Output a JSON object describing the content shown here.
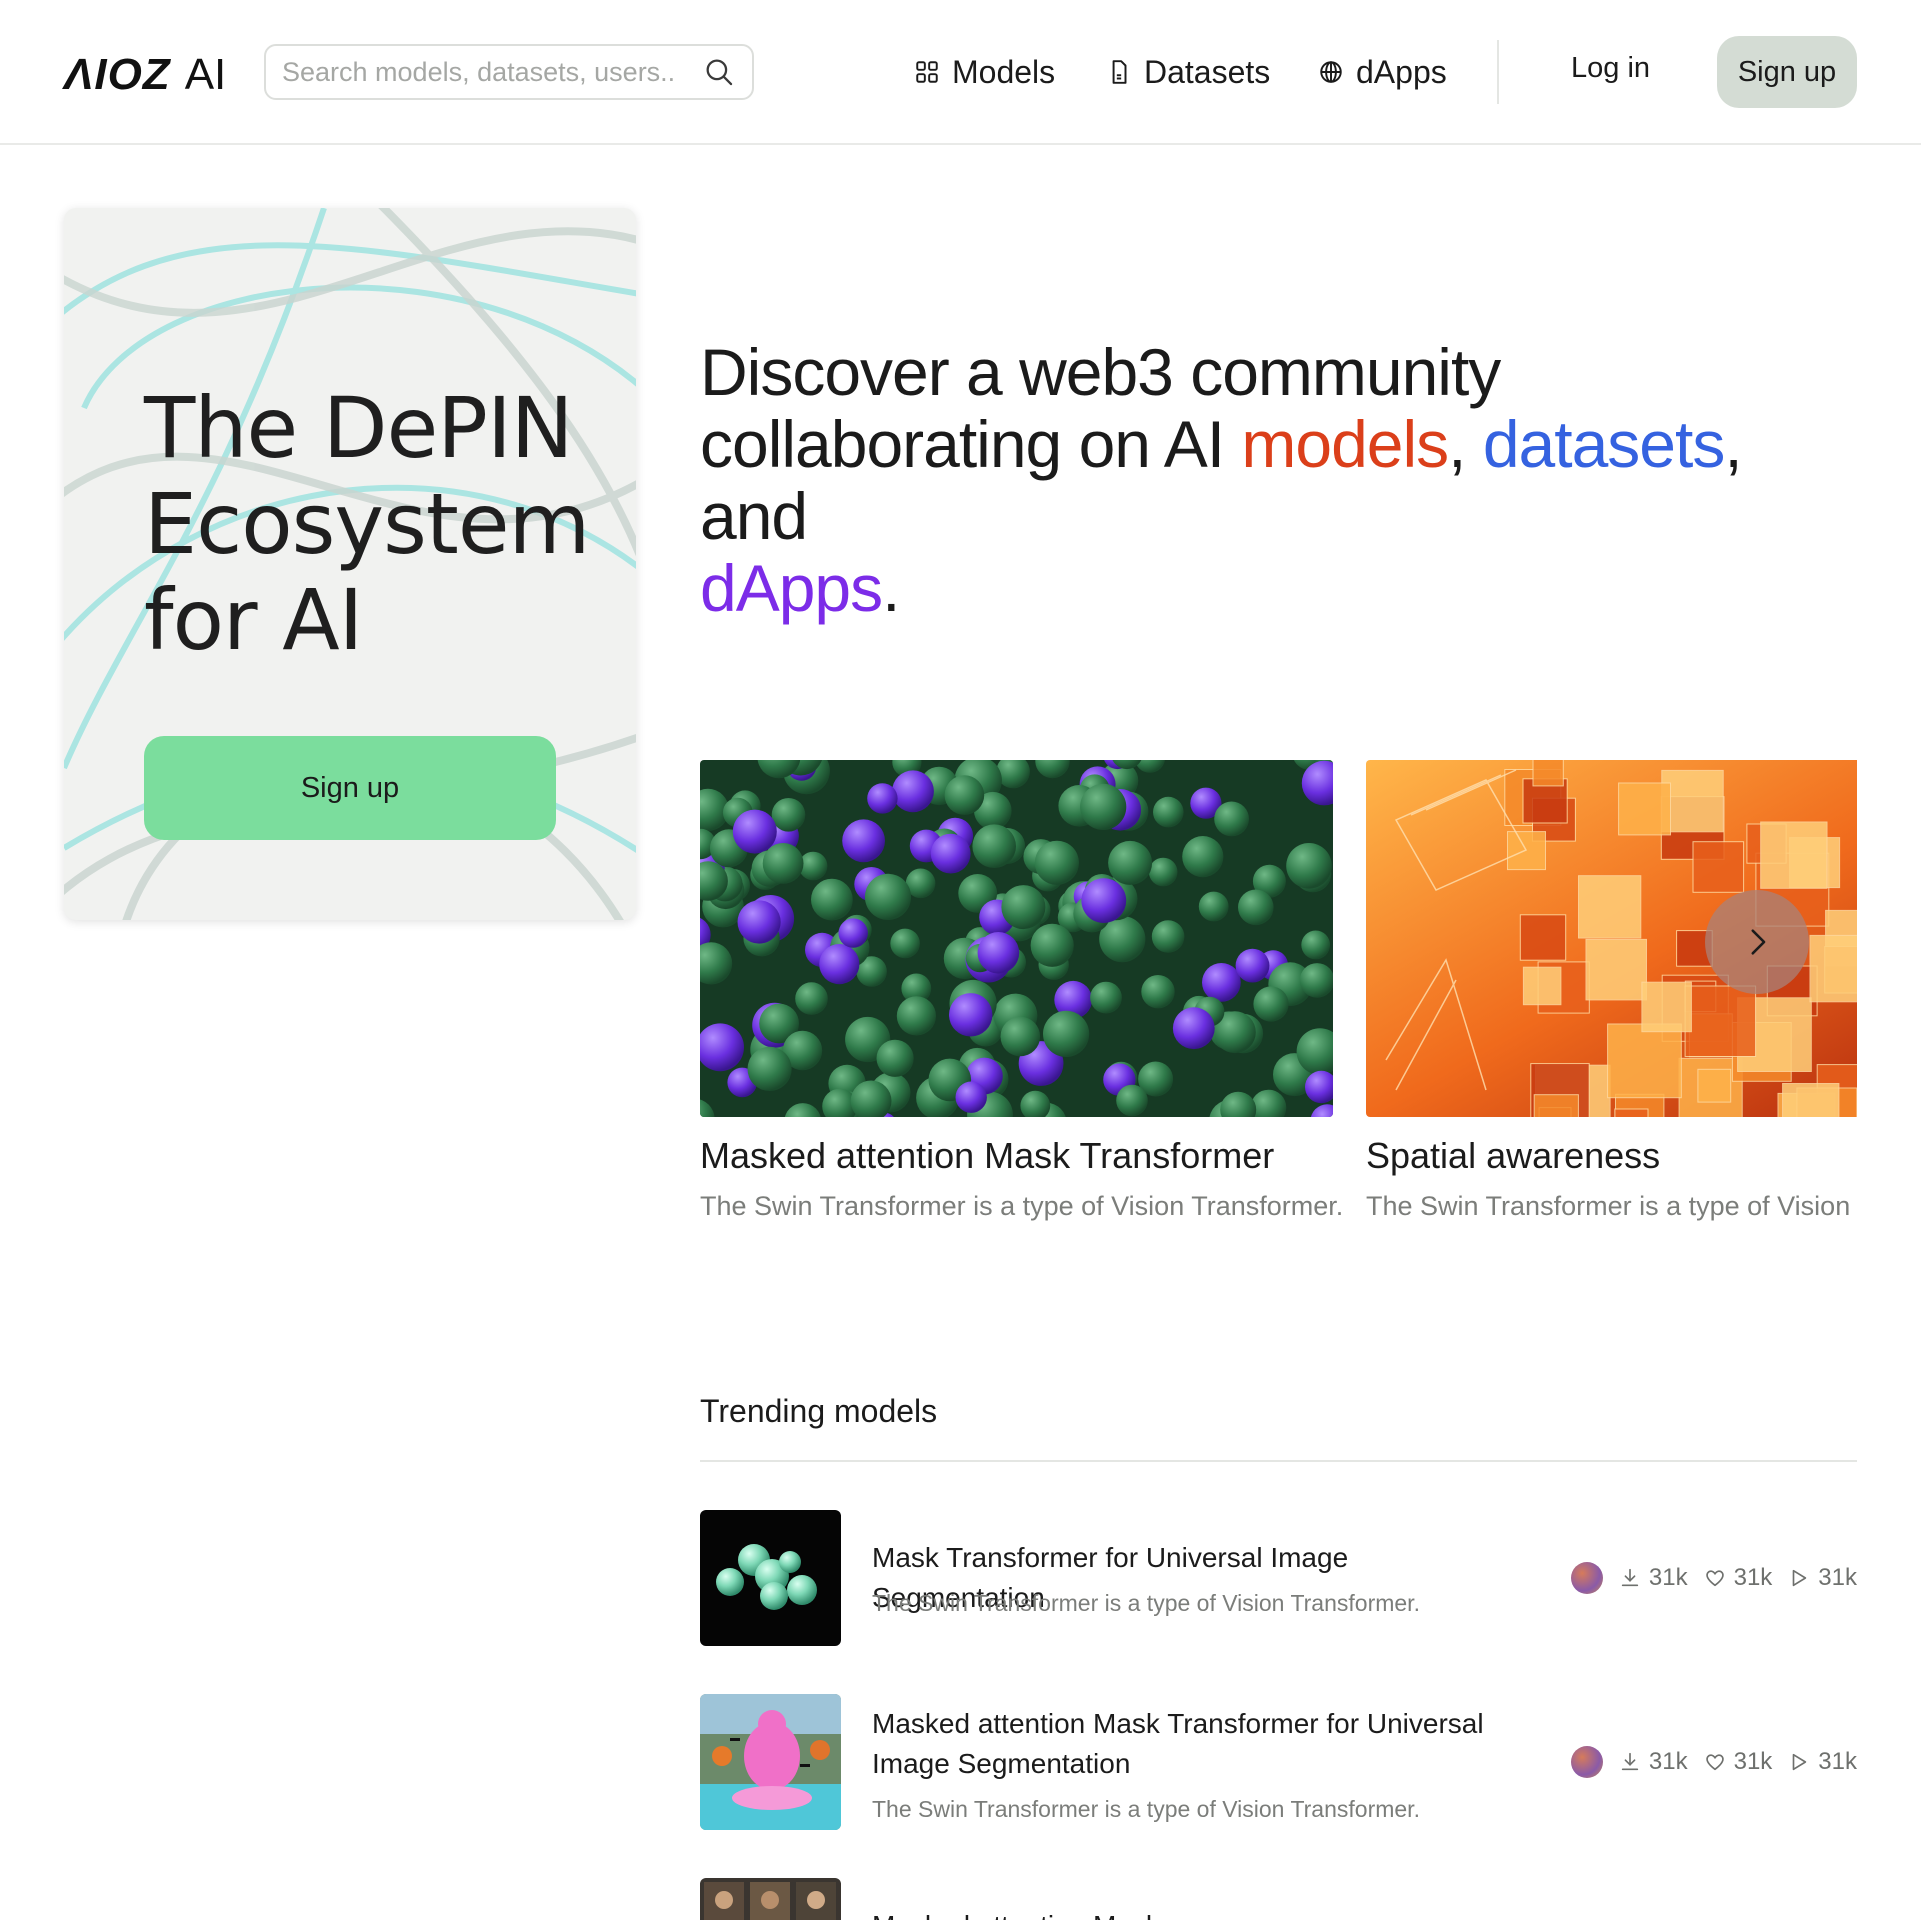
{
  "header": {
    "logo_mark": "ΛIOZ",
    "logo_text": "AI",
    "search_placeholder": "Search models, datasets, users..",
    "nav": [
      {
        "label": "Models",
        "icon": "grid-icon"
      },
      {
        "label": "Datasets",
        "icon": "document-icon"
      },
      {
        "label": "dApps",
        "icon": "globe-icon"
      }
    ],
    "login_label": "Log in",
    "signup_label": "Sign up"
  },
  "promo": {
    "title": "The DePIN Ecosystem for AI",
    "button_label": "Sign up"
  },
  "hero": {
    "line1": "Discover a web3 community",
    "line2_prefix": "collaborating on AI ",
    "models": "models",
    "comma1": ",",
    "datasets": "datasets",
    "comma2": ",  and",
    "dapps": "dApps",
    "period": ".",
    "colors": {
      "models": "#db3f1a",
      "datasets": "#3562e0",
      "dapps": "#7c2ce8"
    }
  },
  "featured": [
    {
      "title": "Masked attention Mask Transformer",
      "description": "The Swin Transformer is a type of Vision Transformer."
    },
    {
      "title": "Spatial awareness",
      "description": "The Swin Transformer is a type of Vision Transformer."
    }
  ],
  "trending": {
    "heading": "Trending  models",
    "items": [
      {
        "title": "Mask Transformer for Universal Image Segmentation",
        "description": "The Swin Transformer is a type of Vision Transformer.",
        "downloads": "31k",
        "likes": "31k",
        "runs": "31k"
      },
      {
        "title": "Masked attention Mask Transformer for Universal Image Segmentation",
        "description": "The Swin Transformer is a type of Vision Transformer.",
        "downloads": "31k",
        "likes": "31k",
        "runs": "31k"
      },
      {
        "title": "Masked attention Mask",
        "description": "",
        "downloads": "",
        "likes": "",
        "runs": ""
      }
    ]
  }
}
